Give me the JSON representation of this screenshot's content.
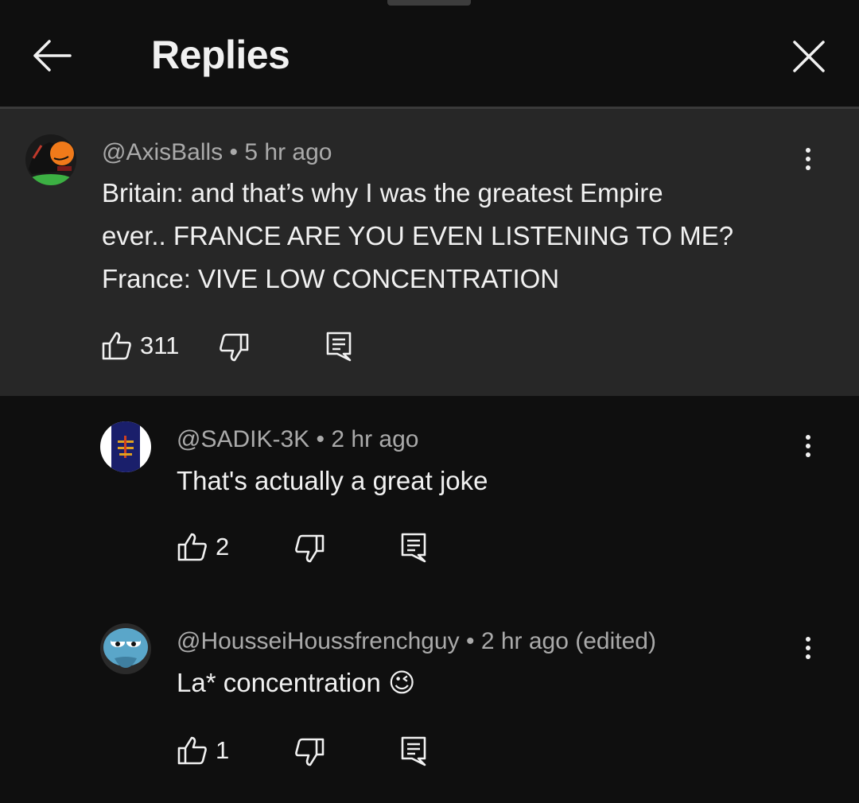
{
  "header": {
    "title": "Replies"
  },
  "comments": [
    {
      "author": "@AxisBalls",
      "separator": "•",
      "time": "5 hr ago",
      "lines": [
        "Britain: and that’s why I was the greatest Empire",
        "ever.. FRANCE ARE YOU EVEN LISTENING TO ME?",
        "France: VIVE LOW CONCENTRATION"
      ],
      "likes": "311"
    },
    {
      "author": "@SADIK-3K",
      "separator": "•",
      "time": "2 hr ago",
      "lines": [
        "That's actually a great joke"
      ],
      "likes": "2"
    },
    {
      "author": "@HousseiHoussfrenchguy",
      "separator": "•",
      "time": "2 hr ago (edited)",
      "lines": [
        "La* concentration 😉"
      ],
      "likes": "1"
    }
  ],
  "icons": {
    "back": "arrow-left-icon",
    "close": "close-icon",
    "more": "more-vert-icon",
    "like": "thumb-up-icon",
    "dislike": "thumb-down-icon",
    "reply": "reply-icon"
  },
  "colors": {
    "background": "#0f0f0f",
    "highlight": "#272727",
    "secondary_text": "#aaaaaa"
  }
}
